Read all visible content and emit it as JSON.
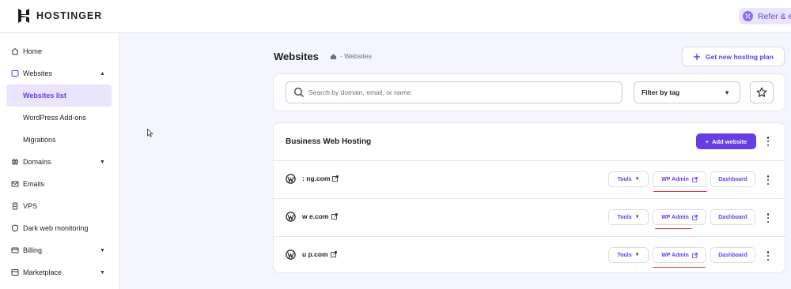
{
  "brand": {
    "name": "HOSTINGER"
  },
  "header": {
    "refer_label": "Refer & ea"
  },
  "sidebar": {
    "items": [
      {
        "label": "Home",
        "icon": "home-icon"
      },
      {
        "label": "Websites",
        "icon": "browser-icon",
        "expanded": true
      },
      {
        "label": "Domains",
        "icon": "globe-icon"
      },
      {
        "label": "Emails",
        "icon": "mail-icon"
      },
      {
        "label": "VPS",
        "icon": "server-icon"
      },
      {
        "label": "Dark web monitoring",
        "icon": "shield-icon"
      },
      {
        "label": "Billing",
        "icon": "card-icon"
      },
      {
        "label": "Marketplace",
        "icon": "store-icon"
      }
    ],
    "websites_sub": [
      {
        "label": "Websites list",
        "active": true
      },
      {
        "label": "WordPress Add-ons"
      },
      {
        "label": "Migrations"
      }
    ]
  },
  "main": {
    "title": "Websites",
    "breadcrumb": "- Websites",
    "get_plan_label": "Get new hosting plan",
    "search_placeholder": "Search by domain, email, or name",
    "filter_label": "Filter by tag",
    "plan_title": "Business Web Hosting",
    "add_website_label": "Add website",
    "sites": [
      {
        "domain": ": ng.com"
      },
      {
        "domain": "w e.com"
      },
      {
        "domain": "u p.com"
      }
    ],
    "tools_label": "Tools",
    "wp_admin_label": "WP Admin",
    "dashboard_label": "Dashboard"
  },
  "colors": {
    "accent": "#673de6",
    "accent_light": "#ebe4ff",
    "annotation_red": "#d8373b"
  }
}
